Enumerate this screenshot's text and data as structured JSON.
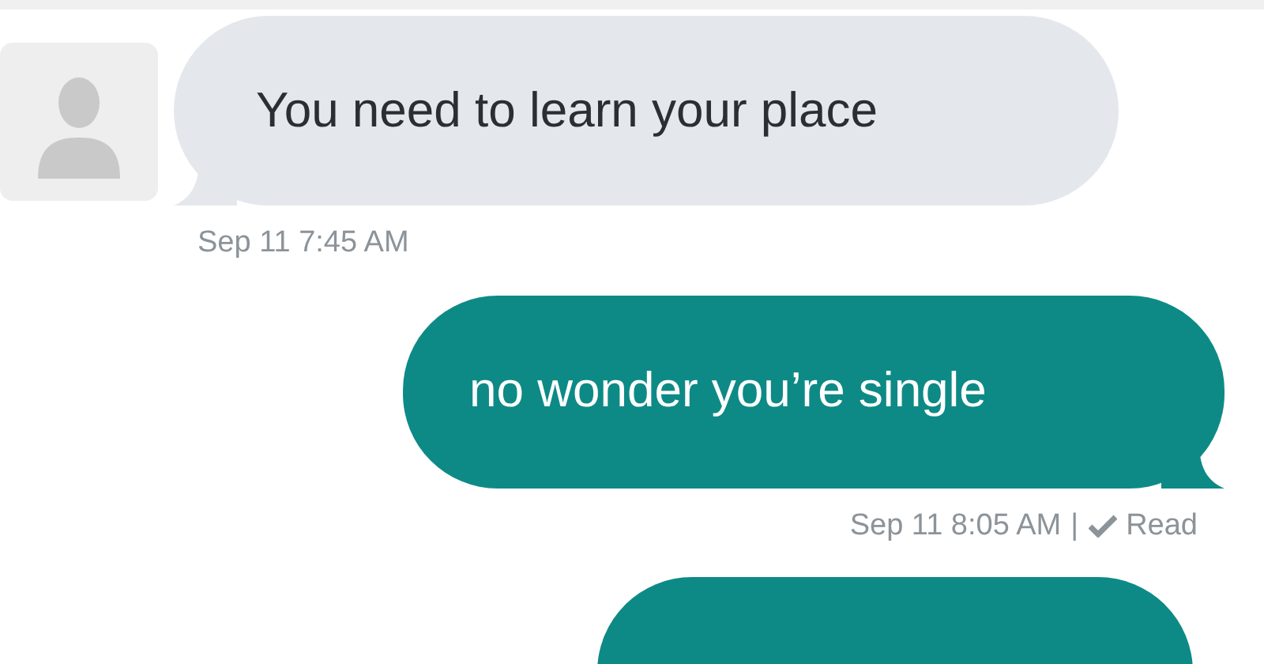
{
  "messages": [
    {
      "kind": "incoming",
      "text": "You need to learn your place",
      "meta": {
        "time": "Sep 11 7:45 AM"
      }
    },
    {
      "kind": "outgoing",
      "text": "no wonder you’re single",
      "meta": {
        "time": "Sep 11 8:05 AM",
        "separator": "|",
        "read": true,
        "status": "Read"
      }
    },
    {
      "kind": "outgoing"
    }
  ]
}
